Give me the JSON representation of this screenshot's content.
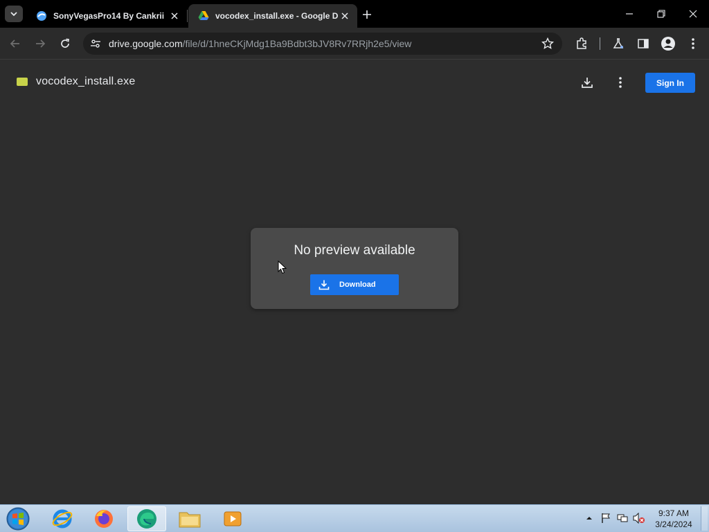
{
  "browser": {
    "tabs": [
      {
        "title": "SonyVegasPro14 By Cankrii",
        "active": false
      },
      {
        "title": "vocodex_install.exe - Google D",
        "active": true
      }
    ],
    "address": {
      "host": "drive.google.com",
      "path": "/file/d/1hneCKjMdg1Ba9Bdbt3bJV8Rv7RRjh2e5/view"
    }
  },
  "viewer": {
    "file_name": "vocodex_install.exe",
    "sign_in_label": "Sign In",
    "preview_message": "No preview available",
    "download_label": "Download"
  },
  "taskbar": {
    "time": "9:37 AM",
    "date": "3/24/2024"
  },
  "colors": {
    "accent": "#1a73e8",
    "viewer_bg": "#2d2d2d",
    "card_bg": "#4a4a4a",
    "file_icon": "#c8d34a"
  }
}
